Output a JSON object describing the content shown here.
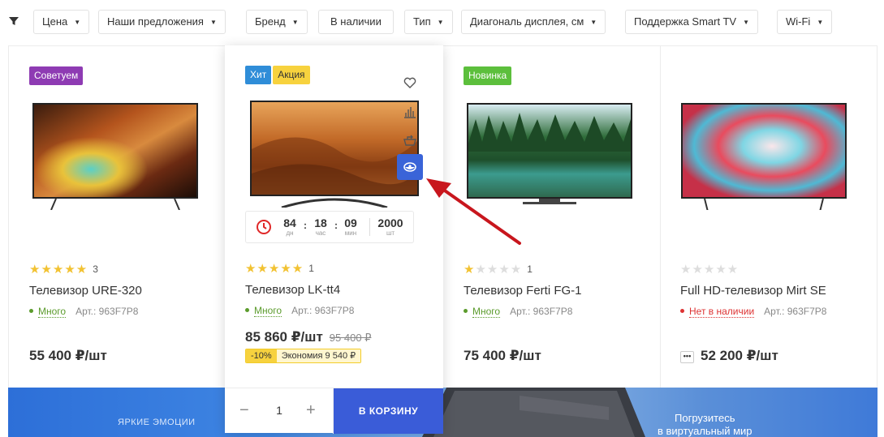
{
  "filters": [
    "Цена",
    "Наши предложения",
    "Бренд",
    "В наличии",
    "Тип",
    "Диагональ дисплея, см",
    "Поддержка Smart TV",
    "Wi-Fi"
  ],
  "products": [
    {
      "badges": [
        "Советуем"
      ],
      "rating": 5,
      "reviews": "3",
      "title": "Телевизор URE-320",
      "stock": "Много",
      "article": "Арт.: 963F7P8",
      "price": "55 400 ₽/шт"
    },
    {
      "badges": [
        "Хит",
        "Акция"
      ],
      "rating": 5,
      "reviews": "1",
      "title": "Телевизор LK-tt4",
      "stock": "Много",
      "article": "Арт.: 963F7P8",
      "price": "85 860 ₽/шт",
      "old_price": "95 400 ₽",
      "discount": "-10%",
      "savings": "Экономия 9 540 ₽",
      "timer": {
        "days": "84",
        "days_unit": "дн",
        "hours": "18",
        "hours_unit": "час",
        "minutes": "09",
        "minutes_unit": "мин",
        "qty": "2000",
        "qty_unit": "шт"
      },
      "quantity": "1",
      "cart_label": "В КОРЗИНУ"
    },
    {
      "badges": [
        "Новинка"
      ],
      "rating": 1,
      "reviews": "1",
      "title": "Телевизор Ferti FG-1",
      "stock": "Много",
      "article": "Арт.: 963F7P8",
      "price": "75 400 ₽/шт"
    },
    {
      "badges": [],
      "rating": 0,
      "reviews": "",
      "title": "Full HD-телевизор Mirt SE",
      "stock": "Нет в наличии",
      "article": "Арт.: 963F7P8",
      "price": "52 200 ₽/шт"
    }
  ],
  "banner": {
    "left_text": "ЯРКИЕ ЭМОЦИИ",
    "right_text_1": "Погрузитесь",
    "right_text_2": "в виртуальный мир"
  },
  "colors": {
    "accent": "#3a5cd8",
    "badge_recommend": "#8e3bb3",
    "badge_hit": "#2f8dd8",
    "badge_sale": "#f7d23e",
    "badge_new": "#5cbf3c",
    "arrow": "#c8161d",
    "star": "#f2c232"
  },
  "icons": [
    "filter-icon",
    "heart-icon",
    "compare-icon",
    "cart-out-icon",
    "quick-view-eye-icon",
    "clock-icon",
    "more-icon"
  ]
}
